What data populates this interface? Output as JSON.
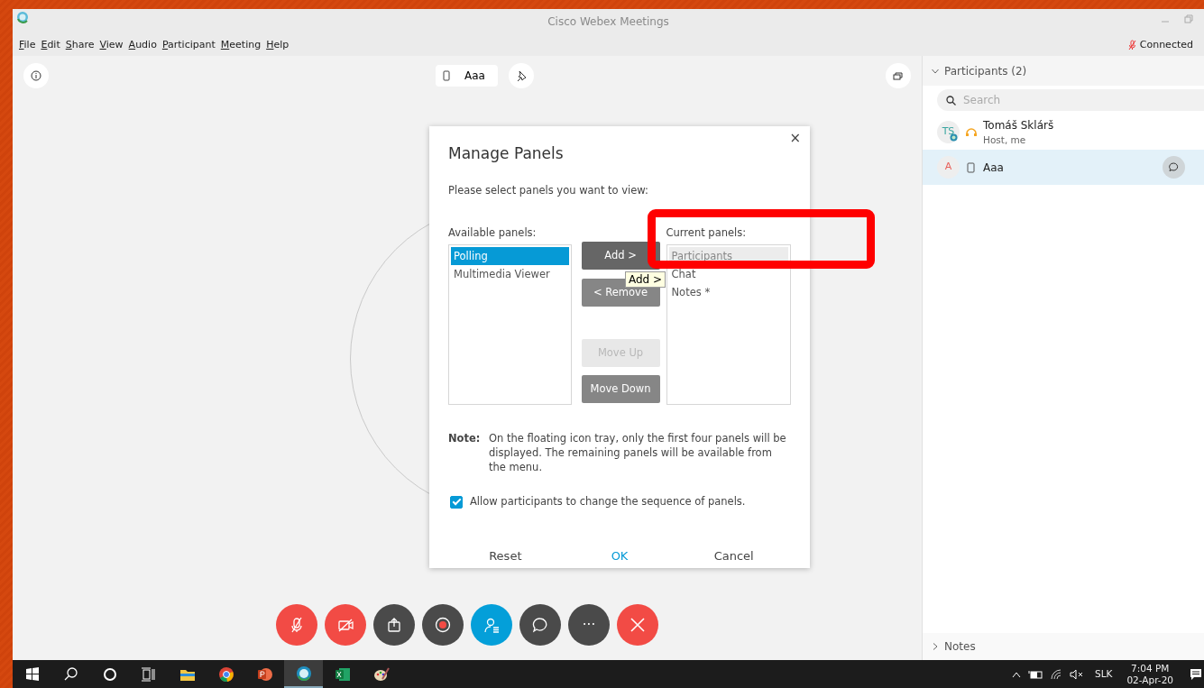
{
  "window": {
    "title": "Cisco Webex Meetings"
  },
  "menu": [
    "File",
    "Edit",
    "Share",
    "View",
    "Audio",
    "Participant",
    "Meeting",
    "Help"
  ],
  "connection": {
    "label": "Connected"
  },
  "stage": {
    "device_label": "Aaa"
  },
  "dialog": {
    "title": "Manage Panels",
    "close": "×",
    "instruction": "Please select panels you want to view:",
    "available_label": "Available panels:",
    "available": [
      {
        "label": "Polling",
        "selected": true
      },
      {
        "label": "Multimedia Viewer",
        "selected": false
      }
    ],
    "buttons": [
      {
        "label": "Add >",
        "disabled": false,
        "highlighted": true
      },
      {
        "label": "< Remove",
        "disabled": false,
        "highlighted": false
      },
      {
        "label": "Move Up",
        "disabled": true,
        "highlighted": false
      },
      {
        "label": "Move Down",
        "disabled": false,
        "highlighted": false
      }
    ],
    "current_label": "Current panels:",
    "current": [
      {
        "label": "Participants",
        "selected": true
      },
      {
        "label": "Chat",
        "selected": false
      },
      {
        "label": "Notes *",
        "selected": false
      }
    ],
    "tooltip": "Add >",
    "note_label": "Note:",
    "note_text": "On the floating icon tray, only the first four panels will be displayed. The remaining panels will be available from the menu.",
    "checkbox": {
      "label": "Allow participants to change the sequence of panels.",
      "checked": true
    },
    "footer": [
      {
        "label": "Reset",
        "kind": "plain"
      },
      {
        "label": "OK",
        "kind": "primary"
      },
      {
        "label": "Cancel",
        "kind": "plain"
      }
    ]
  },
  "controls": [
    {
      "kind": "mute",
      "selected": false
    },
    {
      "kind": "video",
      "selected": false
    },
    {
      "kind": "share",
      "selected": false
    },
    {
      "kind": "record",
      "selected": false
    },
    {
      "kind": "participants",
      "selected": true
    },
    {
      "kind": "chat",
      "selected": false
    },
    {
      "kind": "more",
      "label": "···",
      "selected": false
    },
    {
      "kind": "leave",
      "selected": false
    }
  ],
  "participants_panel": {
    "header": "Participants (2)",
    "expanded": true,
    "search": {
      "placeholder": "Search"
    },
    "participants": [
      {
        "initials": "TS",
        "name": "Tomáš Sklárš",
        "role": "Host, me",
        "kind": "headset",
        "selected": false,
        "color": "#3aa6a0"
      },
      {
        "initials": "A",
        "name": "Aaa",
        "kind": "phone",
        "selected": true,
        "color": "#e8605a"
      }
    ]
  },
  "notes_panel": {
    "header": "Notes",
    "expanded": false
  },
  "taskbar": {
    "apps": [
      {
        "kind": "start",
        "selected": false
      },
      {
        "kind": "search",
        "selected": false
      },
      {
        "kind": "cortana",
        "selected": false
      },
      {
        "kind": "taskview",
        "selected": false
      },
      {
        "kind": "explorer",
        "selected": false
      },
      {
        "kind": "chrome",
        "selected": false
      },
      {
        "kind": "powerpoint",
        "selected": false
      },
      {
        "kind": "webex",
        "selected": true
      },
      {
        "kind": "excel",
        "selected": false
      },
      {
        "kind": "paint",
        "selected": false
      }
    ],
    "language": "SLK",
    "time": "7:04 PM",
    "date": "02-Apr-20"
  }
}
